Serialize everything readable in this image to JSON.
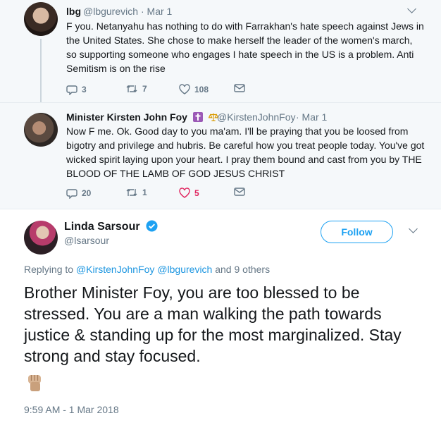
{
  "tweet1": {
    "name": "lbg",
    "handle": "@lbgurevich",
    "date": "· Mar 1",
    "text": "F you. Netanyahu has nothing to do with Farrakhan's hate speech against Jews in the United States. She chose to make herself the leader of the women's march, so supporting someone who engages I hate speech in the US is a problem. Anti Semitism is on the rise",
    "replies": "3",
    "retweets": "7",
    "likes": "108"
  },
  "tweet2": {
    "name": "Minister Kirsten John Foy",
    "handle": "@KirstenJohnFoy",
    "date": "· Mar 1",
    "text": "Now F me. Ok. Good day to you ma'am. I'll be praying that you be loosed from bigotry and privilege and hubris. Be careful how you treat people today. You've got wicked spirit laying upon your heart. I pray them bound and cast from you by THE BLOOD OF THE LAMB OF GOD JESUS CHRIST",
    "replies": "20",
    "retweets": "1",
    "likes": "5"
  },
  "main": {
    "name": "Linda Sarsour",
    "handle": "@lsarsour",
    "follow_label": "Follow",
    "replying_prefix": "Replying to",
    "mention1": "@KirstenJohnFoy",
    "mention2": "@lbgurevich",
    "replying_suffix": "and 9 others",
    "text": "Brother Minister Foy, you are too blessed to be stressed. You are a man walking the path towards justice & standing up for the most marginalized. Stay strong and stay focused.",
    "timestamp": "9:59 AM - 1 Mar 2018"
  },
  "colors": {
    "accent": "#1da1f2",
    "like": "#e0245e",
    "muted": "#657786",
    "thread_bg": "#f5f8fa"
  }
}
